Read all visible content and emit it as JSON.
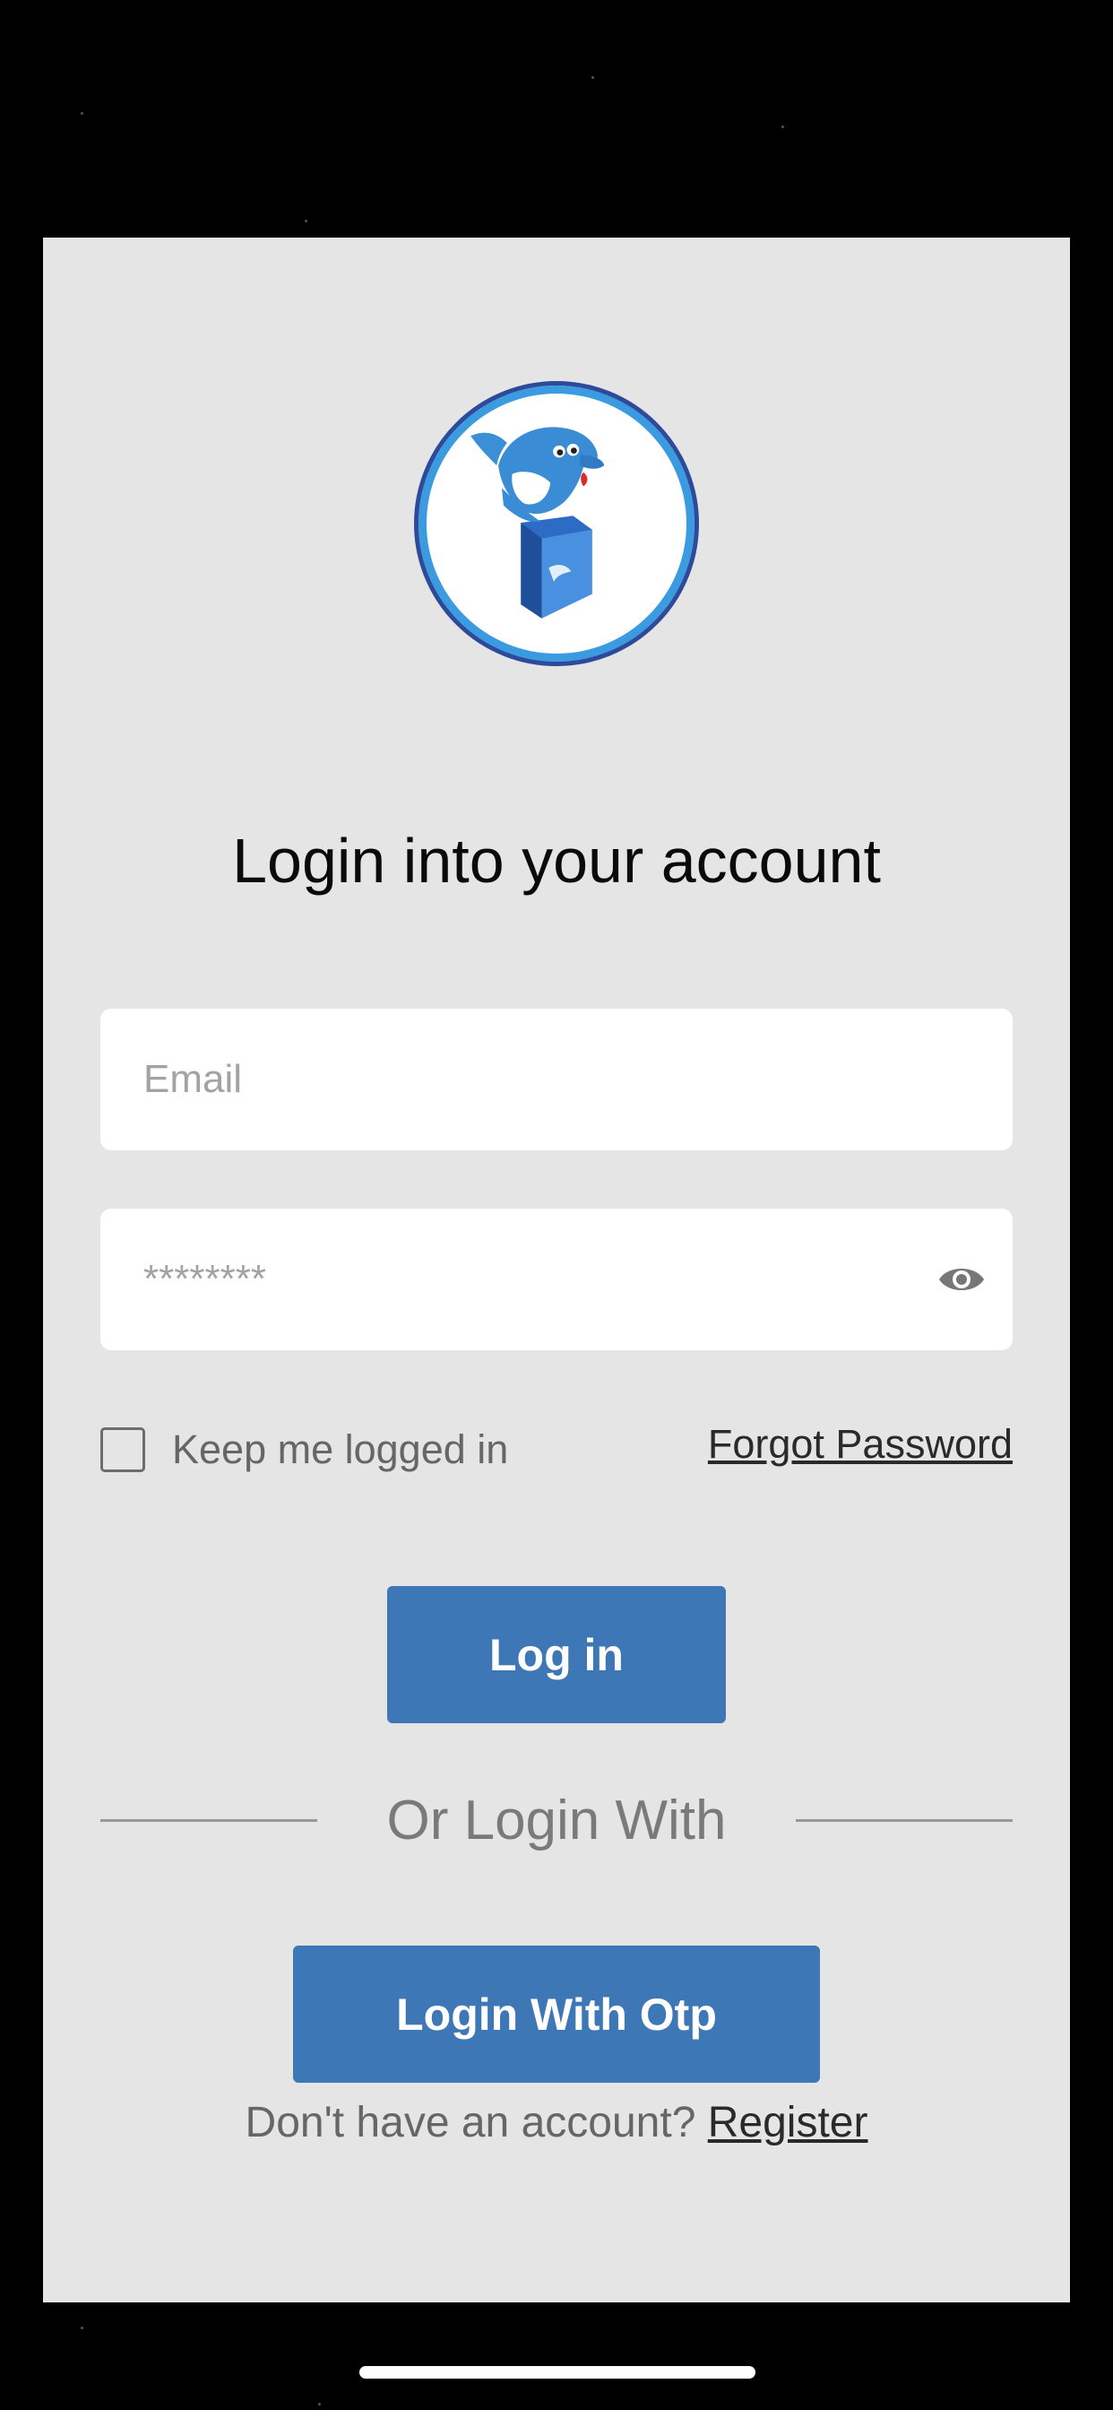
{
  "login": {
    "title": "Login into your account",
    "email_placeholder": "Email",
    "password_placeholder": "********",
    "keep_logged_in_label": "Keep me logged in",
    "forgot_password_label": "Forgot Password",
    "login_button_label": "Log in",
    "divider_text": "Or Login With",
    "otp_button_label": "Login With Otp",
    "no_account_text": "Don't have an account?",
    "register_label": "Register"
  },
  "icons": {
    "logo": "dolphin-book-logo",
    "password_toggle": "eye-icon"
  },
  "colors": {
    "background": "#000000",
    "card": "#e5e5e6",
    "button": "#3e77b6",
    "logo_ring": "#3b9be0"
  }
}
